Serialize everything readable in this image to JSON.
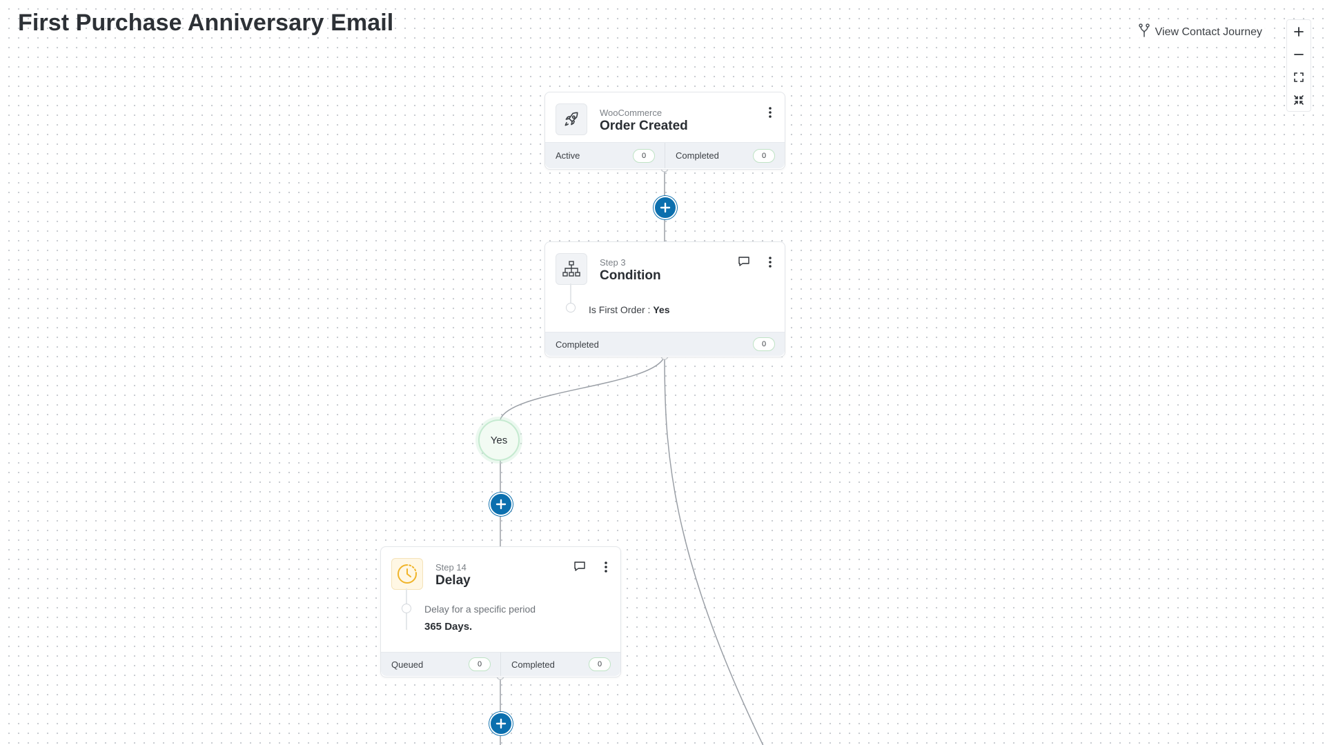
{
  "page": {
    "title": "First Purchase Anniversary Email"
  },
  "header": {
    "view_journey_label": "View Contact Journey"
  },
  "zoom_controls": [
    "zoom-in-icon",
    "zoom-out-icon",
    "fit-view-icon",
    "collapse-icon"
  ],
  "nodes": {
    "trigger": {
      "subtitle": "WooCommerce",
      "title": "Order Created",
      "icon": "rocket-icon",
      "footer": [
        {
          "label": "Active",
          "count": "0"
        },
        {
          "label": "Completed",
          "count": "0"
        }
      ]
    },
    "condition": {
      "subtitle": "Step 3",
      "title": "Condition",
      "icon": "hierarchy-icon",
      "rule_label": "Is First Order :",
      "rule_value": "Yes",
      "footer": [
        {
          "label": "Completed",
          "count": "0"
        }
      ]
    },
    "branch": {
      "yes_label": "Yes"
    },
    "delay": {
      "subtitle": "Step 14",
      "title": "Delay",
      "icon": "clock-icon",
      "description": "Delay for a specific period",
      "value": "365 Days.",
      "footer": [
        {
          "label": "Queued",
          "count": "0"
        },
        {
          "label": "Completed",
          "count": "0"
        }
      ]
    }
  },
  "colors": {
    "accent": "#0b6fae",
    "count_border": "#bfe3c5",
    "yes_bubble_bg": "#f2fbf3",
    "delay_icon": "#f0b429"
  }
}
